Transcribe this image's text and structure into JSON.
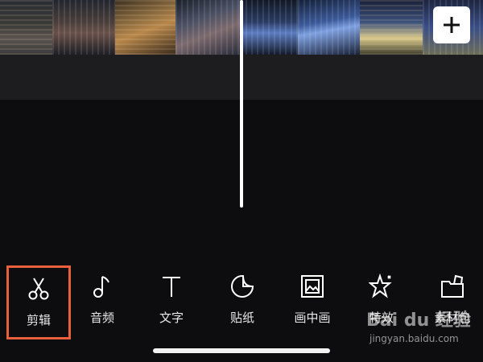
{
  "toolbar": {
    "items": [
      {
        "label": "剪辑",
        "icon": "scissors-icon"
      },
      {
        "label": "音频",
        "icon": "music-note-icon"
      },
      {
        "label": "文字",
        "icon": "text-icon"
      },
      {
        "label": "贴纸",
        "icon": "sticker-icon"
      },
      {
        "label": "画中画",
        "icon": "picture-in-picture-icon"
      },
      {
        "label": "特效",
        "icon": "star-effect-icon"
      },
      {
        "label": "素材包",
        "icon": "material-pack-icon"
      }
    ],
    "selected_index": 0
  },
  "timeline": {
    "add_button_icon": "plus-icon"
  },
  "watermark": {
    "logo": "Bai du 经验",
    "url": "jingyan.baidu.com"
  },
  "colors": {
    "background": "#0d0d0f",
    "track": "#1d1d20",
    "highlight": "#e8603c",
    "icon": "#ffffff"
  }
}
